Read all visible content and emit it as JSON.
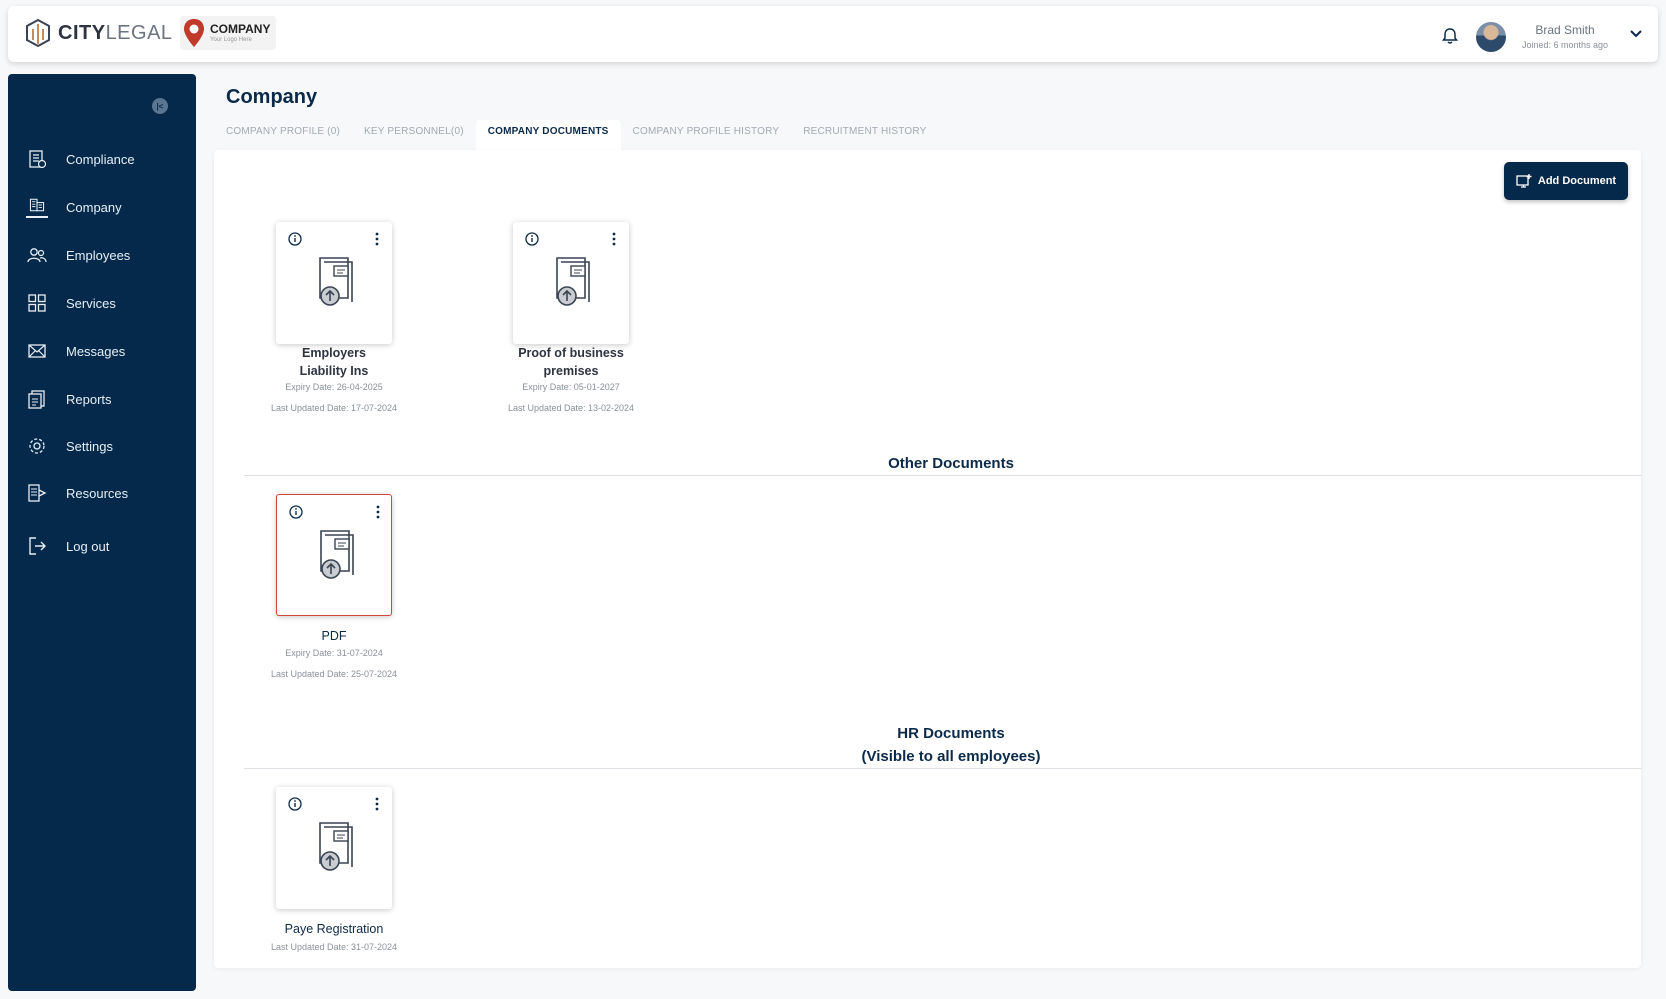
{
  "header": {
    "brand_bold": "CITY",
    "brand_light": "LEGAL",
    "company_logo_title": "COMPANY",
    "company_logo_sub": "Your Logo Here",
    "user_name": "Brad Smith",
    "user_joined": "Joined: 6 months ago"
  },
  "sidebar": {
    "items": [
      {
        "label": "Compliance",
        "icon": "building-check-icon"
      },
      {
        "label": "Company",
        "icon": "company-icon"
      },
      {
        "label": "Employees",
        "icon": "users-icon"
      },
      {
        "label": "Services",
        "icon": "grid-icon"
      },
      {
        "label": "Messages",
        "icon": "envelope-icon"
      },
      {
        "label": "Reports",
        "icon": "report-icon"
      },
      {
        "label": "Settings",
        "icon": "gear-icon"
      },
      {
        "label": "Resources",
        "icon": "resources-icon"
      },
      {
        "label": "Log out",
        "icon": "logout-icon"
      }
    ]
  },
  "page": {
    "title": "Company",
    "tabs": [
      {
        "label": "COMPANY PROFILE (0)"
      },
      {
        "label": "KEY PERSONNEL(0)"
      },
      {
        "label": "COMPANY DOCUMENTS"
      },
      {
        "label": "COMPANY PROFILE HISTORY"
      },
      {
        "label": "RECRUITMENT HISTORY"
      }
    ],
    "add_document_label": "Add Document"
  },
  "documents": {
    "company": [
      {
        "title_line1": "Employers",
        "title_line2": "Liability Ins",
        "expiry": "Expiry Date: 26-04-2025",
        "updated": "Last Updated Date: 17-07-2024"
      },
      {
        "title_line1": "Proof of business",
        "title_line2": "premises",
        "expiry": "Expiry Date: 05-01-2027",
        "updated": "Last Updated Date: 13-02-2024"
      }
    ],
    "other_heading": "Other Documents",
    "other": [
      {
        "title": "PDF",
        "expiry": "Expiry Date: 31-07-2024",
        "updated": "Last Updated Date: 25-07-2024"
      }
    ],
    "hr_heading_line1": "HR Documents",
    "hr_heading_line2": "(Visible to all employees)",
    "hr": [
      {
        "title": "Paye Registration",
        "updated": "Last Updated Date: 31-07-2024"
      }
    ]
  },
  "colors": {
    "navy": "#04294a",
    "selected_border": "#d0453c"
  }
}
